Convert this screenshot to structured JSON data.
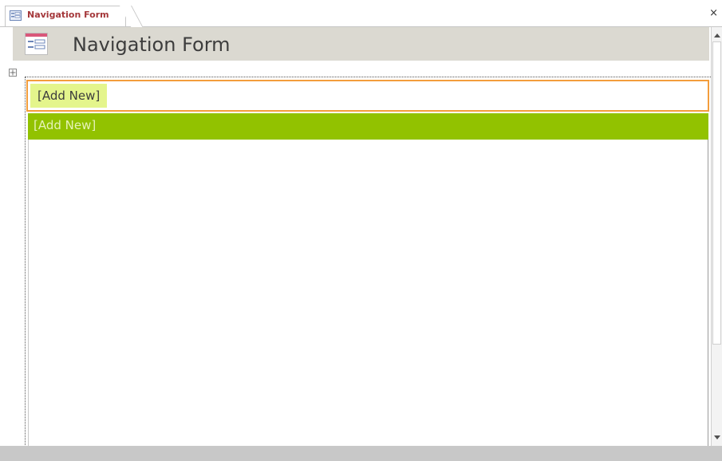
{
  "document_tab": {
    "label": "Navigation Form",
    "icon": "form-icon",
    "close_icon": "close-icon",
    "close_glyph": "×"
  },
  "header": {
    "title": "Navigation Form",
    "icon": "form-icon"
  },
  "navigation": {
    "tabs": [
      {
        "label": "[Add New]"
      }
    ],
    "subtabs": [
      {
        "label": "[Add New]"
      }
    ]
  },
  "colors": {
    "tab_label": "#a4373a",
    "header_band": "#dbd9d1",
    "selection_outline": "#f39d3c",
    "add_new_highlight": "#e4f58c",
    "subtab_bar": "#92c200"
  }
}
